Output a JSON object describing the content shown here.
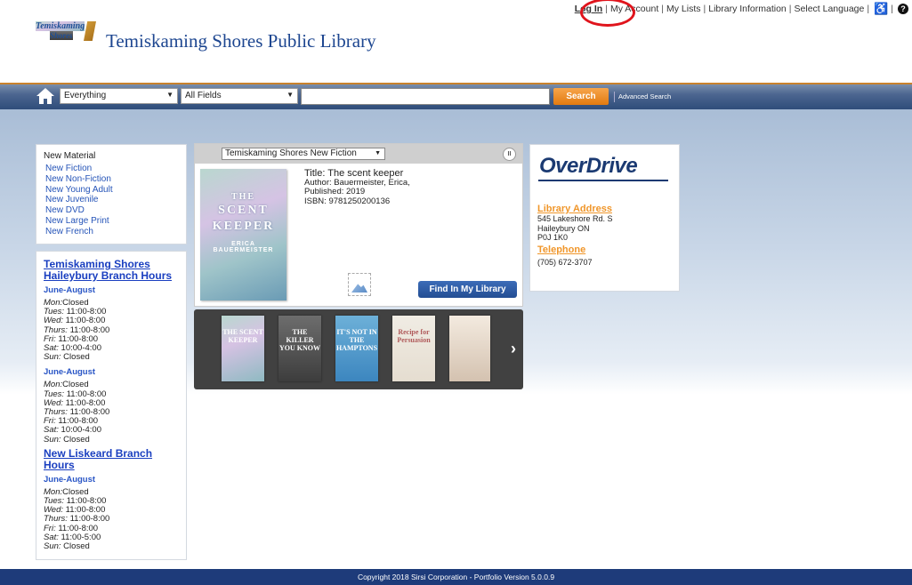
{
  "top_links": {
    "login": "Log In",
    "my_account": "My Account",
    "my_lists": "My Lists",
    "library_info": "Library Information",
    "select_language": "Select Language",
    "sep": "|"
  },
  "header": {
    "logo_line1": "Temiskaming",
    "logo_line2": "Shores",
    "title": "Temiskaming Shores Public Library"
  },
  "search": {
    "scope_value": "Everything",
    "field_value": "All Fields",
    "query_value": "",
    "button_label": "Search",
    "advanced_label": "Advanced Search"
  },
  "new_material": {
    "heading": "New Material",
    "items": [
      "New Fiction",
      "New Non-Fiction",
      "New Young Adult",
      "New Juvenile",
      "New DVD",
      "New Large Print",
      "New French"
    ]
  },
  "hours": {
    "branches": [
      {
        "name": "Temiskaming Shores Haileybury Branch Hours",
        "seasons": [
          {
            "label": "June-August",
            "rows": [
              {
                "day": "Mon:",
                "time": "Closed"
              },
              {
                "day": "Tues:",
                "time": " 11:00-8:00"
              },
              {
                "day": "Wed:",
                "time": " 11:00-8:00"
              },
              {
                "day": "Thurs:",
                "time": " 11:00-8:00"
              },
              {
                "day": "Fri:",
                "time": " 11:00-8:00"
              },
              {
                "day": "Sat:",
                "time": " 10:00-4:00"
              },
              {
                "day": "Sun:",
                "time": " Closed"
              }
            ]
          },
          {
            "label": "June-August",
            "rows": [
              {
                "day": "Mon:",
                "time": "Closed"
              },
              {
                "day": "Tues:",
                "time": " 11:00-8:00"
              },
              {
                "day": "Wed:",
                "time": " 11:00-8:00"
              },
              {
                "day": "Thurs:",
                "time": " 11:00-8:00"
              },
              {
                "day": "Fri:",
                "time": " 11:00-8:00"
              },
              {
                "day": "Sat:",
                "time": " 10:00-4:00"
              },
              {
                "day": "Sun:",
                "time": " Closed"
              }
            ]
          }
        ]
      },
      {
        "name": "New Liskeard Branch Hours",
        "seasons": [
          {
            "label": "June-August",
            "rows": [
              {
                "day": "Mon:",
                "time": "Closed"
              },
              {
                "day": "Tues:",
                "time": " 11:00-8:00"
              },
              {
                "day": "Wed:",
                "time": " 11:00-8:00"
              },
              {
                "day": "Thurs:",
                "time": " 11:00-8:00"
              },
              {
                "day": "Fri:",
                "time": " 11:00-8:00"
              },
              {
                "day": "Sat:",
                "time": " 11:00-5:00"
              },
              {
                "day": "Sun:",
                "time": " Closed"
              }
            ]
          }
        ]
      }
    ]
  },
  "carousel": {
    "list_value": "Temiskaming Shores New Fiction",
    "pause_label": "II",
    "cover": {
      "line1": "THE",
      "line2": "SCENT",
      "line3": "KEEPER",
      "author1": "ERICA",
      "author2": "BAUERMEISTER"
    },
    "details": {
      "title": "Title: The scent keeper",
      "author": "Author: Bauermeister, Erica,",
      "published": "Published: 2019",
      "isbn": "ISBN: 9781250200136"
    },
    "find_button": "Find In My Library",
    "thumbnails": [
      {
        "text": "THE SCENT KEEPER"
      },
      {
        "text": "THE KILLER YOU KNOW"
      },
      {
        "text": "IT'S NOT IN THE HAMPTONS"
      },
      {
        "text": "Recipe for Persuasion"
      },
      {
        "text": ""
      }
    ],
    "next_label": "›"
  },
  "right_panel": {
    "overdrive": "OverDrive",
    "address_heading": "Library Address",
    "address_lines": [
      "545 Lakeshore Rd. S",
      "Haileybury ON",
      "P0J 1K0"
    ],
    "telephone_heading": "Telephone",
    "telephone": "(705) 672-3707"
  },
  "footer": {
    "text": "Copyright 2018 Sirsi Corporation - Portfolio Version 5.0.0.9"
  },
  "colors": {
    "brand_blue": "#1d4690",
    "accent_orange": "#f0962a",
    "annotation_red": "#e0141c"
  }
}
